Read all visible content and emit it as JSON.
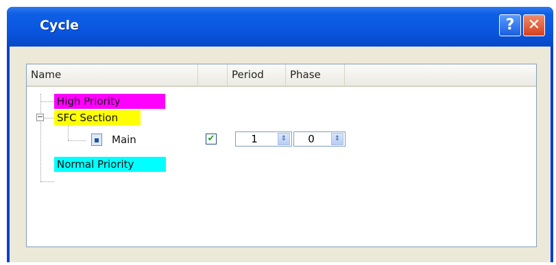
{
  "window": {
    "title": "Cycle",
    "help_label": "?",
    "close_label": "✕"
  },
  "columns": {
    "name": "Name",
    "period": "Period",
    "phase": "Phase"
  },
  "tree": {
    "high_priority": "High Priority",
    "sfc_section": "SFC Section",
    "main": "Main",
    "normal_priority": "Normal Priority",
    "expander_symbol": "−"
  },
  "main_row": {
    "enabled_mark": "✔",
    "period_value": "1",
    "phase_value": "0",
    "spin_symbol": "⇕"
  },
  "colors": {
    "high_priority": "#ff00ff",
    "sfc_section": "#ffff00",
    "normal_priority": "#00ffff"
  },
  "icons": {
    "help": "help-icon",
    "close": "close-icon",
    "task": "task-icon"
  }
}
